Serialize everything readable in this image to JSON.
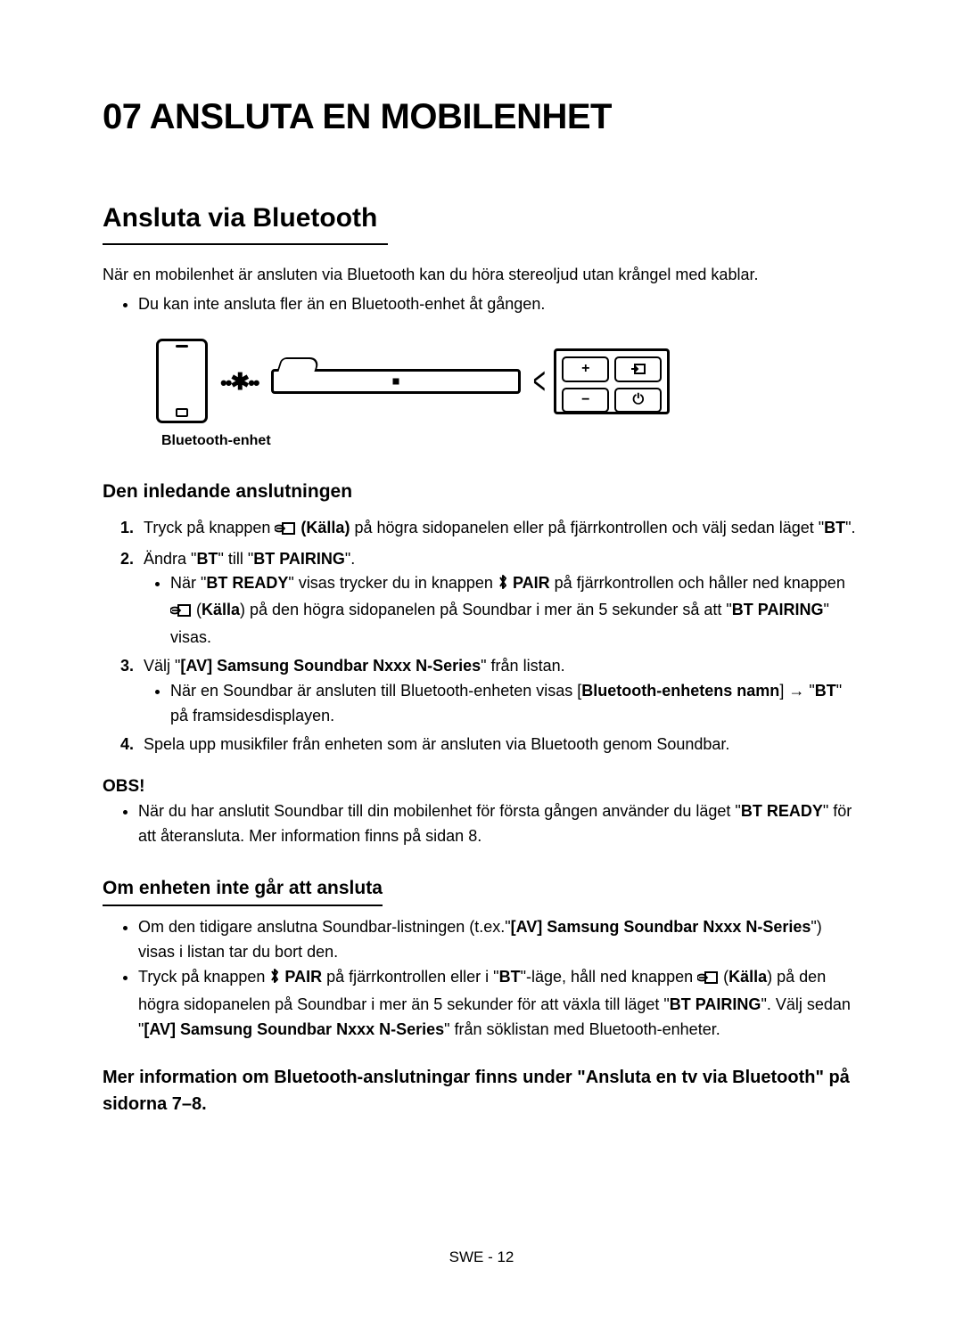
{
  "chapter_title": "07   ANSLUTA EN MOBILENHET",
  "section_title": "Ansluta via Bluetooth",
  "intro": "När en mobilenhet är ansluten via Bluetooth kan du höra stereoljud utan krångel med kablar.",
  "intro_bullet": "Du kan inte ansluta fler än en Bluetooth-enhet åt gången.",
  "diagram_label": "Bluetooth-enhet",
  "sub1": "Den inledande anslutningen",
  "step1_a": "Tryck på knappen ",
  "step1_b": " (Källa)",
  "step1_c": " på högra sidopanelen eller på fjärrkontrollen och välj sedan läget \"",
  "step1_bt": "BT",
  "step1_d": "\".",
  "step2_a": "Ändra \"",
  "step2_bt": "BT",
  "step2_b": "\" till \"",
  "step2_pair": "BT PAIRING",
  "step2_c": "\".",
  "step2_sub_a": "När \"",
  "step2_sub_ready": "BT READY",
  "step2_sub_b": "\" visas trycker du in knappen ",
  "step2_sub_pair": " PAIR",
  "step2_sub_c": " på fjärrkontrollen och håller ned knappen ",
  "step2_sub_kalla": "Källa",
  "step2_sub_d": ") på den högra sidopanelen på Soundbar i mer än 5 sekunder så att \"",
  "step2_sub_btp": "BT PAIRING",
  "step2_sub_e": "\" visas.",
  "step3_a": "Välj \"",
  "step3_av": "[AV] Samsung Soundbar Nxxx N-Series",
  "step3_b": "\"  från listan.",
  "step3_sub_a": "När en Soundbar är ansluten till Bluetooth-enheten visas [",
  "step3_sub_name": "Bluetooth-enhetens namn",
  "step3_sub_b": "] → \"",
  "step3_sub_bt": "BT",
  "step3_sub_c": "\" på framsidesdisplayen.",
  "step4": "Spela upp musikfiler från enheten som är ansluten via Bluetooth genom Soundbar.",
  "obs": "OBS!",
  "obs_bullet_a": "När du har anslutit Soundbar till din mobilenhet för första gången använder du läget \"",
  "obs_bullet_ready": "BT READY",
  "obs_bullet_b": "\" för att återansluta. Mer information finns på sidan 8.",
  "sub2": "Om enheten inte går att ansluta",
  "fail_b1_a": "Om den tidigare anslutna Soundbar-listningen (t.ex.\"",
  "fail_b1_av": "[AV] Samsung Soundbar Nxxx N-Series",
  "fail_b1_b": "\") visas i listan tar du bort den.",
  "fail_b2_a": "Tryck på knappen ",
  "fail_b2_pair": " PAIR",
  "fail_b2_b": " på fjärrkontrollen eller i \"",
  "fail_b2_bt": "BT",
  "fail_b2_c": "\"-läge, håll ned knappen ",
  "fail_b2_kalla": "Källa",
  "fail_b2_d": ") på den högra sidopanelen på Soundbar i mer än 5 sekunder för att växla till läget \"",
  "fail_b2_btp": "BT PAIRING",
  "fail_b2_e": "\".  Välj sedan \"",
  "fail_b2_av": "[AV] Samsung Soundbar Nxxx N-Series",
  "fail_b2_f": "\" från söklistan med Bluetooth-enheter.",
  "footer_info": "Mer information om Bluetooth-anslutningar finns under \"Ansluta en tv via Bluetooth\" på sidorna 7–8.",
  "page_footer": "SWE - 12"
}
